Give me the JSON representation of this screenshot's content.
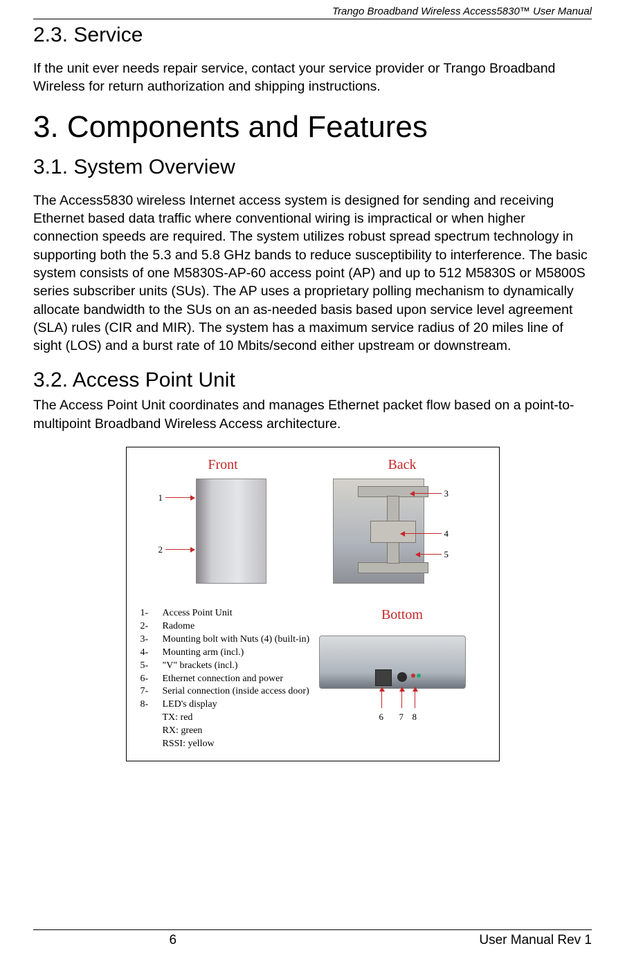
{
  "header": {
    "running_title": "Trango Broadband Wireless Access5830™  User Manual"
  },
  "sections": {
    "s23_title": "2.3. Service",
    "s23_body": "If the unit ever needs repair service, contact your service provider or Trango Broadband Wireless for return authorization and shipping instructions.",
    "ch3_title": "3.  Components and Features",
    "s31_title": "3.1.  System Overview",
    "s31_body": "The Access5830 wireless Internet access system is designed for sending and receiving Ethernet based data traffic where conventional wiring is impractical or when higher connection speeds are required.  The system utilizes robust spread spectrum technology in supporting both the 5.3 and 5.8 GHz bands to reduce susceptibility to interference. The basic system consists of one M5830S-AP-60 access point (AP) and up to 512 M5830S or M5800S series subscriber units (SUs).  The AP uses a proprietary polling mechanism to dynamically allocate bandwidth to the SUs on an as-needed basis based upon service level agreement (SLA) rules (CIR and MIR).  The system has a maximum service radius of 20 miles line of sight (LOS) and a burst rate of 10 Mbits/second either upstream or downstream.",
    "s32_title": "3.2.  Access Point Unit",
    "s32_body": "The Access Point Unit coordinates and manages Ethernet packet flow based on a point-to-multipoint Broadband Wireless Access architecture."
  },
  "diagram": {
    "front_label": "Front",
    "back_label": "Back",
    "bottom_label": "Bottom",
    "callouts": {
      "c1": "1",
      "c2": "2",
      "c3": "3",
      "c4": "4",
      "c5": "5",
      "c6": "6",
      "c7": "7",
      "c8": "8"
    },
    "parts": [
      {
        "num": "1-",
        "desc": "Access Point Unit"
      },
      {
        "num": "2-",
        "desc": "Radome"
      },
      {
        "num": "3-",
        "desc": "Mounting bolt with Nuts (4) (built-in)"
      },
      {
        "num": "4-",
        "desc": "Mounting arm (incl.)"
      },
      {
        "num": "5-",
        "desc": "\"V\" brackets (incl.)"
      },
      {
        "num": "6-",
        "desc": "Ethernet connection and power"
      },
      {
        "num": "7-",
        "desc": "Serial connection (inside access door)"
      },
      {
        "num": "8-",
        "desc": "LED's display\nTX: red\nRX: green\nRSSI: yellow"
      }
    ]
  },
  "footer": {
    "page_number": "6",
    "label": "User Manual Rev 1"
  }
}
